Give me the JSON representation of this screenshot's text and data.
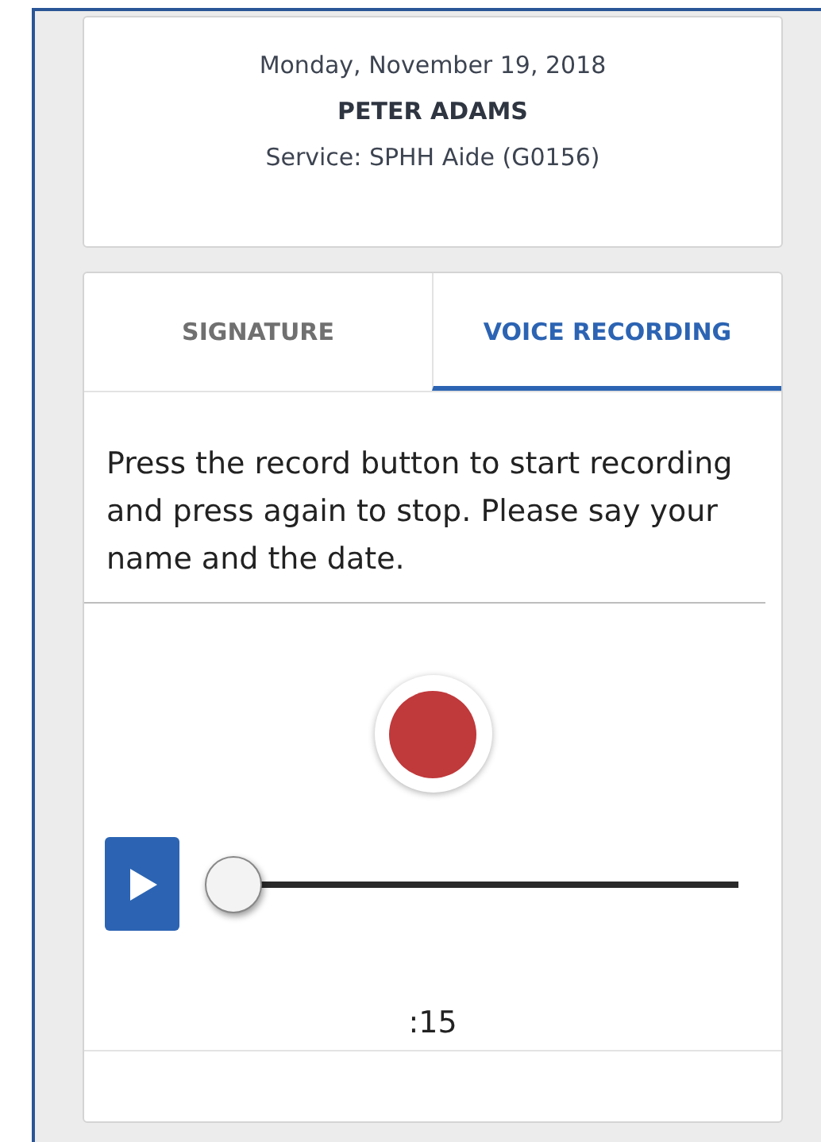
{
  "header": {
    "date": "Monday, November 19, 2018",
    "name": "PETER ADAMS",
    "service": "Service: SPHH Aide (G0156)"
  },
  "tabs": [
    {
      "label": "SIGNATURE",
      "selected": false
    },
    {
      "label": "VOICE RECORDING",
      "selected": true
    }
  ],
  "instructions": "Press the record button to start recording and press again to stop. Please say your name and the date.",
  "player": {
    "level": 0,
    "time": ":15"
  }
}
